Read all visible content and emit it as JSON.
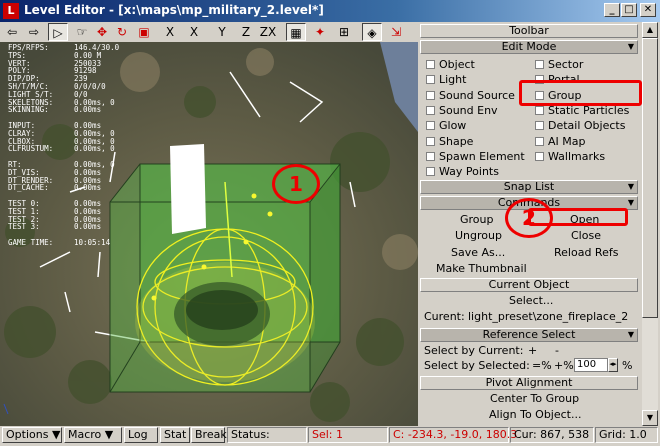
{
  "window": {
    "title": "Level Editor - [x:\\maps\\mp_military_2.level*]",
    "icon": "app-logo-icon",
    "controls": [
      "minimize",
      "maximize",
      "close"
    ]
  },
  "toolbar": {
    "buttons": [
      {
        "name": "undo",
        "glyph": "⇦"
      },
      {
        "name": "redo",
        "glyph": "⇨"
      },
      {
        "name": "select",
        "glyph": "▷"
      },
      {
        "name": "camera",
        "glyph": "☞"
      },
      {
        "name": "move",
        "glyph": "✥"
      },
      {
        "name": "rotate",
        "glyph": "↻"
      },
      {
        "name": "scale",
        "glyph": "▣"
      },
      {
        "name": "clear",
        "glyph": "X"
      },
      {
        "name": "axis-x",
        "glyph": "X"
      },
      {
        "name": "axis-y",
        "glyph": "Y"
      },
      {
        "name": "axis-z",
        "glyph": "Z"
      },
      {
        "name": "axis-zx",
        "glyph": "ZX"
      },
      {
        "name": "csg",
        "glyph": "▦"
      },
      {
        "name": "snap",
        "glyph": "✦"
      },
      {
        "name": "grid",
        "glyph": "⊞"
      },
      {
        "name": "object-snap",
        "glyph": "◈"
      },
      {
        "name": "moving-snap",
        "glyph": "⇲"
      }
    ]
  },
  "stats": [
    [
      "FPS/RFPS:",
      "146.4/30.0"
    ],
    [
      "TPS:",
      "0.00 M"
    ],
    [
      "VERT:",
      "250033"
    ],
    [
      "POLY:",
      "91298"
    ],
    [
      "DIP/DP:",
      "239"
    ],
    [
      "SH/T/M/C:",
      "0/0/0/0"
    ],
    [
      "LIGHT S/T:",
      "0/0"
    ],
    [
      "SKELETONS:",
      "0.00ms, 0"
    ],
    [
      "SKINNING:",
      "0.00ms"
    ],
    null,
    [
      "INPUT:",
      "0.00ms"
    ],
    [
      "CLRAY:",
      "0.00ms, 0"
    ],
    [
      "CLBOX:",
      "0.00ms, 0"
    ],
    [
      "CLFRUSTUM:",
      "0.00ms, 0"
    ],
    null,
    [
      "RT:",
      "0.00ms, 0"
    ],
    [
      "DT_VIS:",
      "0.00ms"
    ],
    [
      "DT_RENDER:",
      "0.00ms"
    ],
    [
      "DT_CACHE:",
      "0.00ms"
    ],
    null,
    [
      "TEST 0:",
      "0.00ms"
    ],
    [
      "TEST 1:",
      "0.00ms"
    ],
    [
      "TEST 2:",
      "0.00ms"
    ],
    [
      "TEST 3:",
      "0.00ms"
    ],
    null,
    [
      "GAME TIME:",
      "10:05:14"
    ]
  ],
  "panel": {
    "toolbar_header": "Toolbar",
    "edit_mode_header": "Edit Mode",
    "edit_mode_left": [
      "Object",
      "Light",
      "Sound Source",
      "Sound Env",
      "Glow",
      "Shape",
      "Spawn Element",
      "Way Points"
    ],
    "edit_mode_right": [
      "Sector",
      "Portal",
      "Group",
      "Static Particles",
      "Detail Objects",
      "AI Map",
      "Wallmarks"
    ],
    "snap_list_header": "Snap List",
    "commands_header": "Commands",
    "commands": {
      "group": "Group",
      "open": "Open",
      "ungroup": "Ungroup",
      "close": "Close",
      "save_as": "Save As...",
      "reload_refs": "Reload Refs",
      "make_thumbnail": "Make Thumbnail"
    },
    "current_object_header": "Current Object",
    "select_label": "Select...",
    "current_label": "Curent:",
    "current_value": "light_preset\\zone_fireplace_2",
    "reference_select_header": "Reference Select",
    "select_by_current": "Select by Current:",
    "select_by_selected": "Select by Selected:",
    "plus": "+",
    "minus": "-",
    "eq_minus": "=%",
    "plus_pct": "+%",
    "percent_value": "100",
    "pct_sign": "%",
    "pivot_header": "Pivot Alignment",
    "center_to_group": "Center To Group",
    "align_to_object": "Align To Object..."
  },
  "annotations": {
    "marker_1": "1",
    "marker_2": "2",
    "accent": "#e00000"
  },
  "statusbar": {
    "options": "Options",
    "macro": "Macro",
    "log": "Log",
    "stat": "Stat",
    "break": "Break",
    "status": "Status:",
    "sel": "Sel: 1",
    "coords": "C: -234.3, -19.0, 180.3",
    "cur": "Cur: 867, 538",
    "grid": "Grid: 1.0"
  }
}
